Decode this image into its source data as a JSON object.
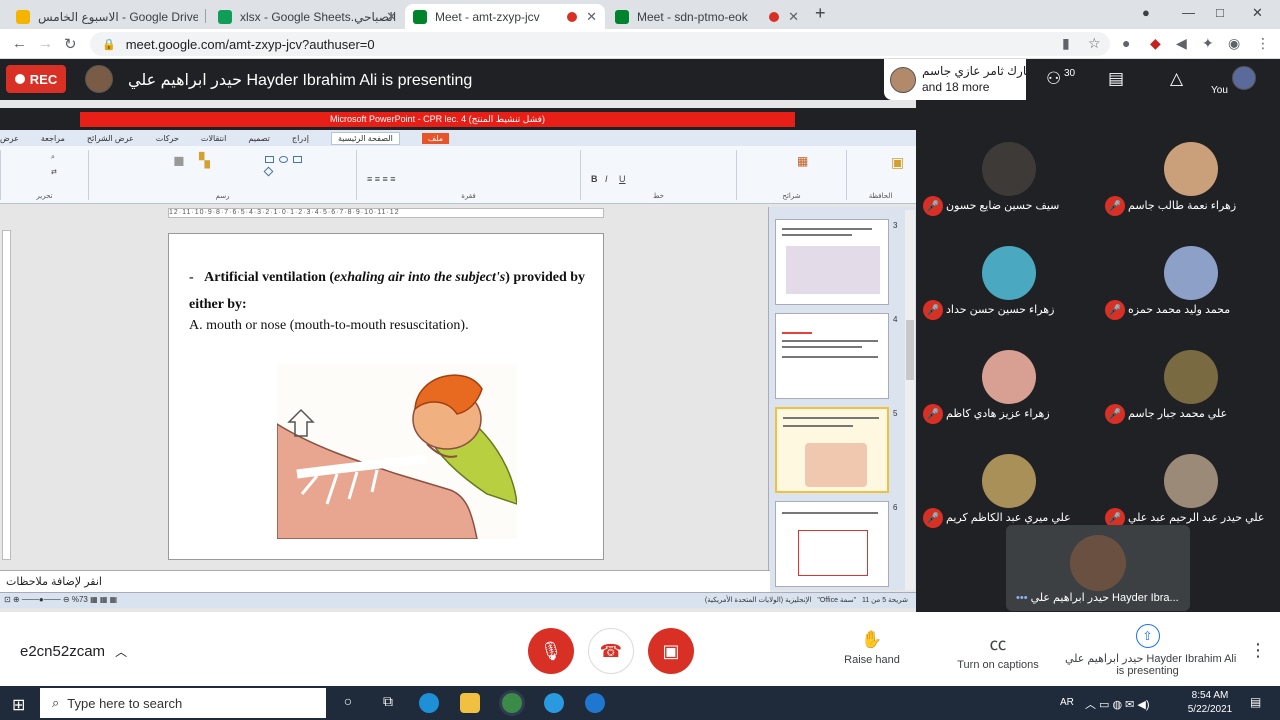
{
  "browser": {
    "tabs": [
      {
        "label": "الاسبوع الخامس - Google Drive",
        "color": "#f4b400"
      },
      {
        "label": "xlsx - Google Sheets.الصباحي",
        "color": "#0f9d58"
      },
      {
        "label": "Meet - amt-zxyp-jcv",
        "color": "#00832d"
      },
      {
        "label": "Meet - sdn-ptmo-eok",
        "color": "#00832d"
      }
    ],
    "url": "meet.google.com/amt-zxyp-jcv?authuser=0"
  },
  "header": {
    "rec_label": "REC",
    "presenting_title": "حيدر ابراهيم علي Hayder Ibrahim Ali is presenting",
    "join_name": "تبارك ثامر عازي جاسم",
    "join_more": "and 18 more",
    "participants_count": "30",
    "you_label": "You"
  },
  "ppt": {
    "title": "Microsoft PowerPoint - CPR lec. 4 (فشل تنشيط المنتج)",
    "ribbon_tabs": [
      "ملف",
      "الصفحة الرئيسية",
      "إدراج",
      "تصميم",
      "انتقالات",
      "حركات",
      "عرض الشرائح",
      "مراجعة",
      "عرض"
    ],
    "groups": [
      "الحافظة",
      "شرائح",
      "خط",
      "فقرة",
      "رسم",
      "تحرير"
    ],
    "ruler": "12·11·10·9·8·7·6·5·4·3·2·1·0·1·2·3·4·5·6·7·8·9·10·11·12",
    "slide": {
      "bullet_bold_1": "Artificial ventilation (",
      "bullet_italic": "exhaling air into the subject's",
      "bullet_bold_2": ") provided by either by:",
      "bullet_dash": "-",
      "item_a": "A. mouth or nose (mouth-to-mouth resuscitation)."
    },
    "thumbnails": [
      "3",
      "4",
      "5",
      "6"
    ],
    "notes_placeholder": "انقر لإضافة ملاحظات",
    "status_left": "شريحة 5 من 11",
    "status_theme": "\"سمة Office\"",
    "status_lang": "الإنجليزية (الولايات المتحدة الأمريكية)",
    "zoom": "%73"
  },
  "participants": [
    {
      "name": "زهراء نعمة طالب جاسم",
      "face": "#c9a07a"
    },
    {
      "name": "سيف حسين ضايع حسون",
      "face": "#3d3a38"
    },
    {
      "name": "محمد وليد محمد حمزه",
      "face": "#8da0c8"
    },
    {
      "name": "زهراء حسين حسن حداد",
      "face": "#4aa9c0"
    },
    {
      "name": "علي محمد جبار جاسم",
      "face": "#7a6a42"
    },
    {
      "name": "زهراء عزيز هادي كاظم",
      "face": "#d8a092"
    },
    {
      "name": "علي حيدر عبد الرحيم عبد علي",
      "face": "#9c8a78"
    },
    {
      "name": "علي ميري عبد الكاظم كريم",
      "face": "#a89058"
    }
  ],
  "self": {
    "name": "حيدر ابراهيم علي Hayder Ibra..."
  },
  "bottom": {
    "meeting_code": "e2cn52zcam",
    "raise_hand": "Raise hand",
    "captions": "Turn on captions",
    "presenter_line1": "حيدر ابراهيم علي Hayder Ibrahim Ali",
    "presenter_line2": "is presenting"
  },
  "taskbar": {
    "search_placeholder": "Type here to search",
    "lang": "AR",
    "time": "8:54 AM",
    "date": "5/22/2021"
  }
}
